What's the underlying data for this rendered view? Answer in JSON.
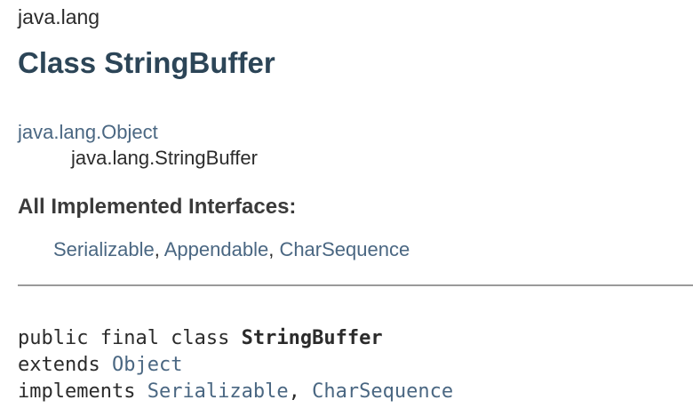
{
  "package": {
    "name": "java.lang"
  },
  "class": {
    "title": "Class StringBuffer"
  },
  "inheritance": {
    "parent": "java.lang.Object",
    "child": "java.lang.StringBuffer"
  },
  "interfaces": {
    "heading": "All Implemented Interfaces:",
    "items": [
      "Serializable",
      "Appendable",
      "CharSequence"
    ],
    "separator": ", "
  },
  "signature": {
    "line1_prefix": "public final class ",
    "class_name": "StringBuffer",
    "line2_prefix": "extends ",
    "extends": "Object",
    "line3_prefix": "implements ",
    "implements": [
      "Serializable",
      "CharSequence"
    ],
    "separator": ", "
  },
  "colors": {
    "title": "#2c4557",
    "link": "#4a6782",
    "text": "#2b2b2b",
    "divider": "#9a9a9a"
  }
}
